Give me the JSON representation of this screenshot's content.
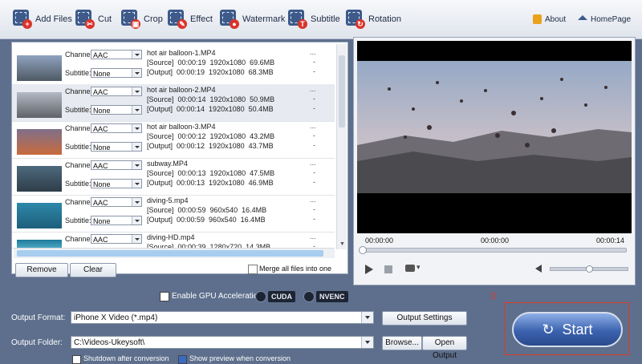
{
  "toolbar": {
    "add_files": "Add Files",
    "cut": "Cut",
    "crop": "Crop",
    "effect": "Effect",
    "watermark": "Watermark",
    "subtitle": "Subtitle",
    "rotation": "Rotation",
    "about": "About",
    "homepage": "HomePage"
  },
  "labels": {
    "channel": "Channel:",
    "subtitle": "Subtitle:"
  },
  "files": [
    {
      "channel": "AAC",
      "subtitle": "None",
      "name": "hot air balloon-1.MP4",
      "source": "[Source]  00:00:19  1920x1080  69.6MB",
      "output": "[Output]  00:00:19  1920x1080  68.3MB"
    },
    {
      "channel": "AAC",
      "subtitle": "None",
      "name": "hot air balloon-2.MP4",
      "source": "[Source]  00:00:14  1920x1080  50.9MB",
      "output": "[Output]  00:00:14  1920x1080  50.4MB"
    },
    {
      "channel": "AAC",
      "subtitle": "None",
      "name": "hot air balloon-3.MP4",
      "source": "[Source]  00:00:12  1920x1080  43.2MB",
      "output": "[Output]  00:00:12  1920x1080  43.7MB"
    },
    {
      "channel": "AAC",
      "subtitle": "None",
      "name": "subway.MP4",
      "source": "[Source]  00:00:13  1920x1080  47.5MB",
      "output": "[Output]  00:00:13  1920x1080  46.9MB"
    },
    {
      "channel": "AAC",
      "subtitle": "None",
      "name": "diving-5.mp4",
      "source": "[Source]  00:00:59  960x540  16.4MB",
      "output": "[Output]  00:00:59  960x540  16.4MB"
    },
    {
      "channel": "AAC",
      "subtitle": "",
      "name": "diving-HD.mp4",
      "source": "[Source]  00:00:39  1280x720  14.3MB",
      "output": ""
    }
  ],
  "list_actions": {
    "remove": "Remove",
    "clear": "Clear",
    "merge": "Merge all files into one"
  },
  "player": {
    "time_current": "00:00:00",
    "time_middle": "00:00:00",
    "time_total": "00:00:14",
    "snapshot_menu": "▾"
  },
  "gpu": {
    "label": "Enable GPU Acceleration",
    "cuda": "CUDA",
    "nvenc": "NVENC"
  },
  "output": {
    "format_label": "Output Format:",
    "format_value": "iPhone X Video (*.mp4)",
    "settings_button": "Output Settings",
    "folder_label": "Output Folder:",
    "folder_value": "C:\\Videos-Ukeysoft\\",
    "browse_button": "Browse...",
    "open_button": "Open Output"
  },
  "bottom_options": {
    "shutdown": "Shutdown after conversion",
    "show_preview": "Show preview when conversion"
  },
  "start": {
    "label": "Start",
    "annotation": "3"
  },
  "colors": {
    "start_outline": "#e0392b",
    "toolbar_badge": "#d9342b",
    "selected_row": "#e7eaf0"
  }
}
